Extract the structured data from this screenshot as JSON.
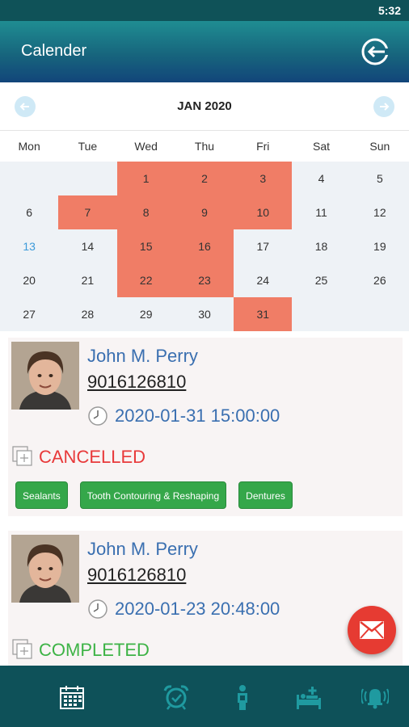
{
  "status_bar": {
    "time": "5:32"
  },
  "app_bar": {
    "title": "Calender",
    "logout_icon": "logout-icon"
  },
  "calendar": {
    "month_label": "JAN 2020",
    "prev_icon": "chevron-left-icon",
    "next_icon": "chevron-right-icon",
    "weekdays": [
      "Mon",
      "Tue",
      "Wed",
      "Thu",
      "Fri",
      "Sat",
      "Sun"
    ],
    "leading_blank_days": 2,
    "days": [
      "1",
      "2",
      "3",
      "4",
      "5",
      "6",
      "7",
      "8",
      "9",
      "10",
      "11",
      "12",
      "13",
      "14",
      "15",
      "16",
      "17",
      "18",
      "19",
      "20",
      "21",
      "22",
      "23",
      "24",
      "25",
      "26",
      "27",
      "28",
      "29",
      "30",
      "31"
    ],
    "booked_days": [
      "1",
      "2",
      "3",
      "7",
      "8",
      "9",
      "10",
      "15",
      "16",
      "22",
      "23",
      "31"
    ],
    "today": "13",
    "booked_color": "#f07d66",
    "today_color": "#3b9ad9"
  },
  "appointments": [
    {
      "name": "John M. Perry",
      "phone": "9016126810",
      "datetime": "2020-01-31 15:00:00",
      "status": "CANCELLED",
      "status_color": "#e8393a",
      "services": [
        "Sealants",
        "Tooth Contouring & Reshaping",
        "Dentures"
      ]
    },
    {
      "name": "John M. Perry",
      "phone": "9016126810",
      "datetime": "2020-01-23 20:48:00",
      "status": "COMPLETED",
      "status_color": "#3db346"
    }
  ],
  "fab": {
    "icon": "mail-icon",
    "color": "#e63b32"
  },
  "bottom_nav": {
    "items": [
      {
        "icon": "calendar-icon",
        "active": true
      },
      {
        "icon": "alarm-clock-icon",
        "active": false
      },
      {
        "icon": "patient-icon",
        "active": false
      },
      {
        "icon": "bed-icon",
        "active": false
      },
      {
        "icon": "notification-bell-icon",
        "active": false
      }
    ]
  },
  "colors": {
    "primary_dark": "#0e5159",
    "accent_teal": "#1f9aa0"
  }
}
